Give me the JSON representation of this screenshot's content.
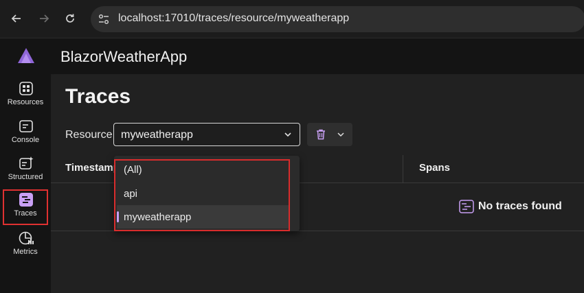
{
  "browser": {
    "url": "localhost:17010/traces/resource/myweatherapp",
    "back_icon": "arrow-left-icon",
    "forward_icon": "arrow-right-icon",
    "reload_icon": "reload-icon"
  },
  "app": {
    "title": "BlazorWeatherApp"
  },
  "sidebar": {
    "items": [
      {
        "label": "Resources",
        "icon": "grid-icon"
      },
      {
        "label": "Console",
        "icon": "console-icon"
      },
      {
        "label": "Structured",
        "icon": "structured-log-icon"
      },
      {
        "label": "Traces",
        "icon": "traces-icon",
        "selected": true
      },
      {
        "label": "Metrics",
        "icon": "metrics-icon"
      }
    ]
  },
  "page": {
    "title": "Traces",
    "resource_label": "Resource",
    "resource_value": "myweatherapp",
    "columns": {
      "timestamp": "Timestamp",
      "spans": "Spans"
    },
    "empty_message": "No traces found"
  },
  "dropdown": {
    "options": [
      {
        "label": "(All)"
      },
      {
        "label": "api"
      },
      {
        "label": "myweatherapp",
        "selected": true
      }
    ]
  },
  "colors": {
    "accent": "#c9a0f5",
    "highlight_border": "#d92c2c"
  }
}
